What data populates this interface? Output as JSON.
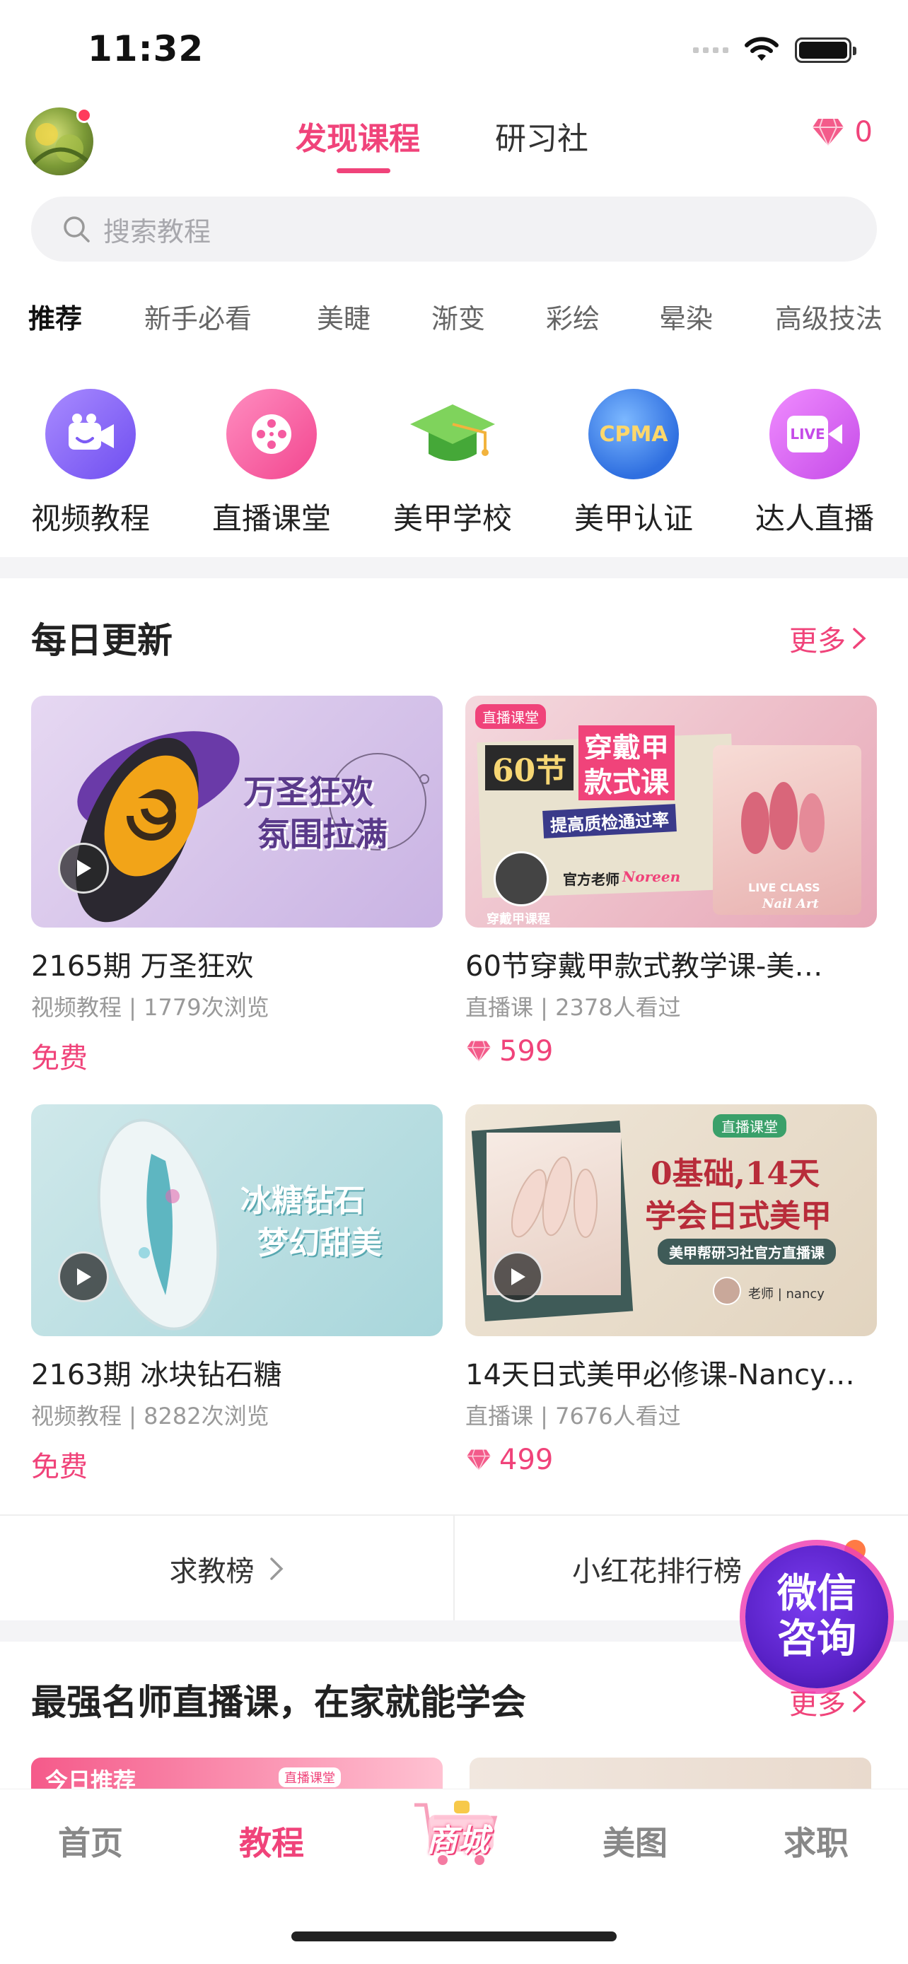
{
  "status_bar": {
    "time": "11:32"
  },
  "header": {
    "tabs": [
      {
        "label": "发现课程",
        "active": true
      },
      {
        "label": "研习社",
        "active": false
      }
    ],
    "diamond_count": "0"
  },
  "search": {
    "placeholder": "搜索教程"
  },
  "categories": [
    "推荐",
    "新手必看",
    "美睫",
    "渐变",
    "彩绘",
    "晕染",
    "高级技法"
  ],
  "quick_links": [
    {
      "label": "视频教程",
      "icon": "video-camera-icon",
      "color": "#8a6cf5"
    },
    {
      "label": "直播课堂",
      "icon": "film-reel-icon",
      "color": "#f55aa0"
    },
    {
      "label": "美甲学校",
      "icon": "graduation-cap-icon",
      "color": "#5cc24a"
    },
    {
      "label": "美甲认证",
      "icon": "cpma-badge-icon",
      "color": "#3a7ee6",
      "badge_text": "CPMA"
    },
    {
      "label": "达人直播",
      "icon": "live-camera-icon",
      "color": "#e85ce6",
      "badge_text": "LIVE"
    }
  ],
  "daily_update": {
    "title": "每日更新",
    "more": "更多",
    "cards": [
      {
        "title": "2165期 万圣狂欢",
        "meta": "视频教程 | 1779次浏览",
        "price": "免费",
        "is_free": true,
        "thumb_lines": [
          "万圣狂欢",
          "氛围拉满"
        ]
      },
      {
        "title": "60节穿戴甲款式教学课-美…",
        "meta": "直播课 | 2378人看过",
        "price": "599",
        "is_free": false,
        "thumb_lines": [
          "直播课堂",
          "60节",
          "穿戴甲",
          "款式课",
          "提高质检通过率",
          "官方老师",
          "Noreen",
          "穿戴甲课程",
          "LIVE CLASS",
          "Nail Art"
        ]
      },
      {
        "title": "2163期 冰块钻石糖",
        "meta": "视频教程 | 8282次浏览",
        "price": "免费",
        "is_free": true,
        "thumb_lines": [
          "冰糖钻石",
          "梦幻甜美"
        ]
      },
      {
        "title": "14天日式美甲必修课-Nancy…",
        "meta": "直播课 | 7676人看过",
        "price": "499",
        "is_free": false,
        "thumb_lines": [
          "直播课堂",
          "0基础,14天",
          "学会日式美甲",
          "美甲帮研习社官方直播课",
          "老师 | nancy"
        ]
      }
    ]
  },
  "rankings": [
    {
      "label": "求教榜"
    },
    {
      "label": "小红花排行榜"
    }
  ],
  "wechat_float": {
    "line1": "微信",
    "line2": "咨询"
  },
  "live_section": {
    "title": "最强名师直播课，在家就能学会",
    "more": "更多",
    "partial_badge": "今日推荐",
    "partial_tag": "直播课堂"
  },
  "tabbar": [
    {
      "label": "首页",
      "active": false
    },
    {
      "label": "教程",
      "active": true
    },
    {
      "label": "商城",
      "active": false,
      "special": true
    },
    {
      "label": "美图",
      "active": false
    },
    {
      "label": "求职",
      "active": false
    }
  ],
  "colors": {
    "accent": "#f0437a",
    "text": "#222222",
    "muted": "#999999",
    "band": "#f4f4f6"
  }
}
